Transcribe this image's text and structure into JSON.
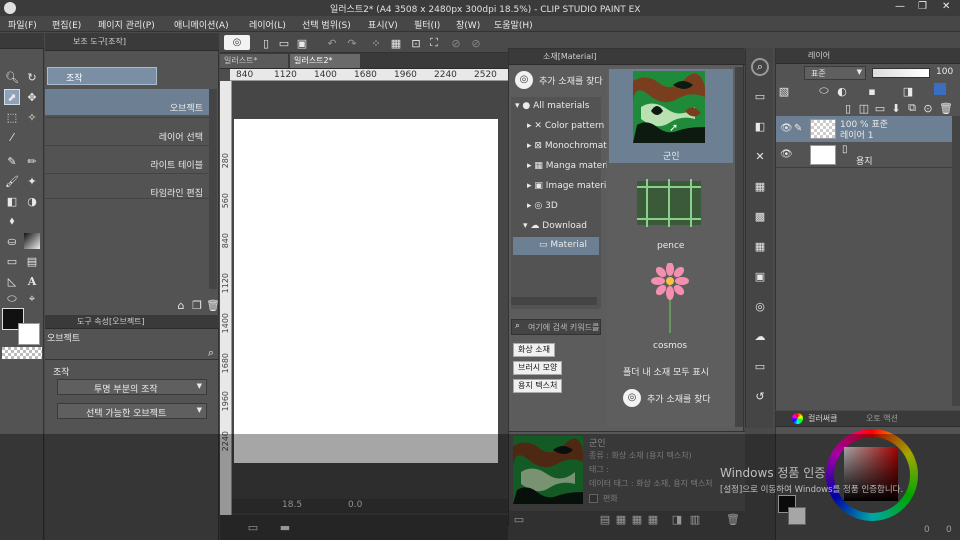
{
  "window": {
    "title": "일러스트2* (A4 3508 x 2480px 300dpi 18.5%) - CLIP STUDIO PAINT EX",
    "controls": [
      "—",
      "❐",
      "✕"
    ]
  },
  "menu": [
    "파일(F)",
    "편집(E)",
    "페이지 관리(P)",
    "애니메이션(A)",
    "레이어(L)",
    "선택 범위(S)",
    "표시(V)",
    "필터(I)",
    "창(W)",
    "도움말(H)"
  ],
  "subtool_panel": {
    "tab_label": "보조 도구[조작]",
    "header": "조작",
    "items": [
      {
        "label": "오브젝트",
        "selected": true
      },
      {
        "label": "레이어 선택",
        "selected": false
      },
      {
        "label": "라이트 테이블",
        "selected": false
      },
      {
        "label": "타임라인 편집",
        "selected": false
      }
    ]
  },
  "tool_props": {
    "tab_label": "도구 속성[오브젝트]",
    "title": "오브젝트",
    "section": "조작",
    "dropdowns": [
      "투명 부분의 조작",
      "선택 가능한 오브젝트"
    ]
  },
  "canvas": {
    "tabs": [
      "일러스트*",
      "일러스트2*"
    ],
    "ruler_h": [
      "840",
      "1120",
      "1400",
      "1680",
      "1960",
      "2240",
      "2520"
    ],
    "ruler_v": [
      "280",
      "560",
      "840",
      "1120",
      "1400",
      "1680",
      "1960",
      "2240"
    ],
    "zoom": "18.5",
    "angle": "0.0"
  },
  "material": {
    "tab_label": "소재[Material]",
    "search_more": "추가 소재를 찾다",
    "tree": [
      {
        "label": "All materials",
        "icon": "●",
        "level": 0,
        "expanded": true
      },
      {
        "label": "Color pattern",
        "icon": "✕",
        "level": 1
      },
      {
        "label": "Monochromatic",
        "icon": "⊠",
        "level": 1
      },
      {
        "label": "Manga material",
        "icon": "▦",
        "level": 1
      },
      {
        "label": "Image material",
        "icon": "▣",
        "level": 1
      },
      {
        "label": "3D",
        "icon": "◎",
        "level": 1
      },
      {
        "label": "Download",
        "icon": "☁",
        "level": 1,
        "expanded": true
      },
      {
        "label": "Material",
        "icon": "▭",
        "level": 2,
        "selected": true
      }
    ],
    "search_placeholder": "여기에 검색 키워드를",
    "tag_buttons": [
      "화상 소재",
      "브러시 모양",
      "용지 텍스처"
    ],
    "items": [
      {
        "name": "군인",
        "selected": true
      },
      {
        "name": "pence",
        "selected": false
      },
      {
        "name": "cosmos",
        "selected": false
      }
    ],
    "show_all": "폴더 내 소재 모두 표시",
    "search_more_bottom": "추가 소재를 찾다",
    "detail": {
      "name": "군인",
      "type": "종류 : 화상 소재 (용지 텍스처)",
      "tag": "태그 :",
      "data_tag": "데이터 태그 : 화상 소재, 용지 텍스처",
      "checkbox": "편화"
    }
  },
  "layers": {
    "tab_label": "레이어",
    "blend_mode": "표준",
    "opacity": "100",
    "items": [
      {
        "line1": "100 % 표준",
        "line2": "레이어 1",
        "selected": true
      },
      {
        "line1": "",
        "line2": "용지",
        "selected": false
      }
    ]
  },
  "color_panel": {
    "tabs": [
      "컬러써클",
      "오토 액션"
    ],
    "sv_value": "0",
    "hue_value": "0"
  },
  "watermark": {
    "line1": "Windows 정품 인증",
    "line2": "[설정]으로 이동하여 Windows를 정품 인증합니다."
  },
  "colors": {
    "accent_selected": "#6d7f92",
    "main_color": "#111111",
    "sub_color": "#ffffff"
  }
}
